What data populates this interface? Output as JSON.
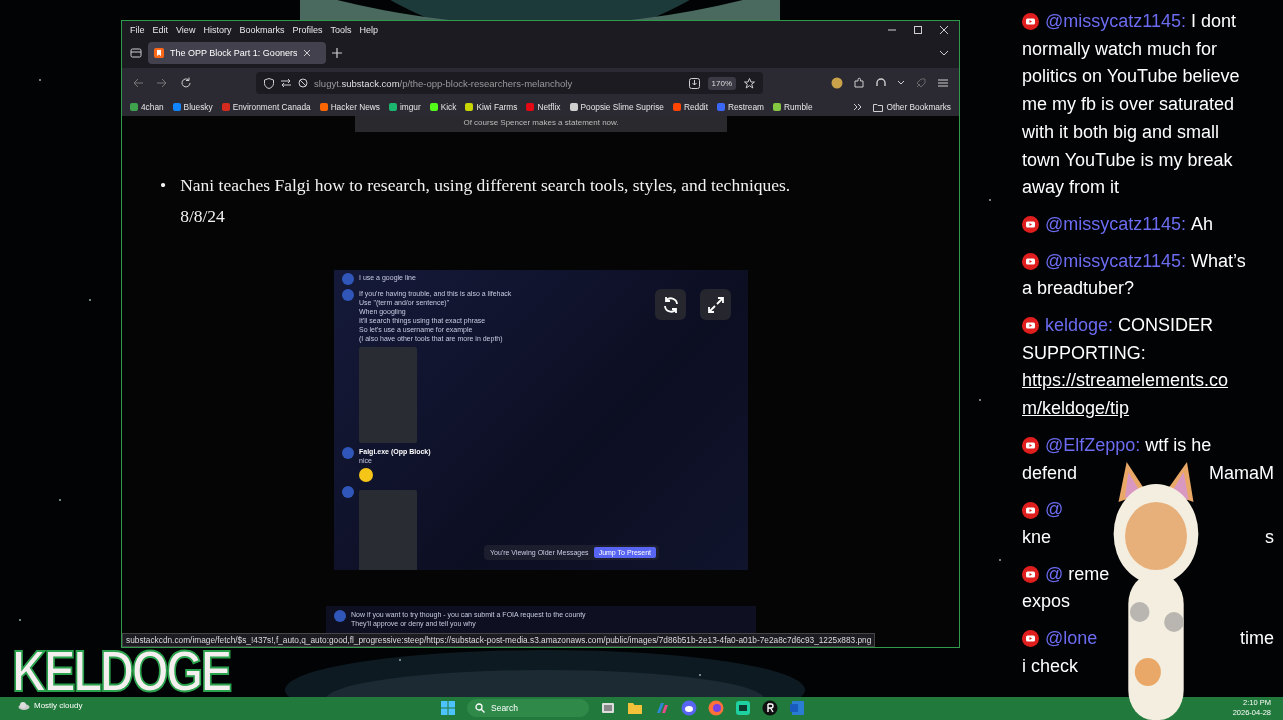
{
  "browser": {
    "menu": [
      "File",
      "Edit",
      "View",
      "History",
      "Bookmarks",
      "Profiles",
      "Tools",
      "Help"
    ],
    "tabs": [
      {
        "title": "The OPP Block Part 1: Gooners",
        "selected": true
      }
    ],
    "url": {
      "sub": "slugyt.",
      "domain": "substack.com",
      "path": "/p/the-opp-block-researchers-melancholy"
    },
    "zoom": "170%",
    "bookmarks": [
      {
        "label": "4chan",
        "color": "#3fa34d"
      },
      {
        "label": "Bluesky",
        "color": "#1185fe"
      },
      {
        "label": "Environment Canada",
        "color": "#d52b1e"
      },
      {
        "label": "Hacker News",
        "color": "#ff6600"
      },
      {
        "label": "imgur",
        "color": "#1bb76e"
      },
      {
        "label": "Kick",
        "color": "#53fc18"
      },
      {
        "label": "Kiwi Farms",
        "color": "#c7d600"
      },
      {
        "label": "Netflix",
        "color": "#e50914"
      },
      {
        "label": "Poopsie Slime Suprise",
        "color": "#d0d0d0"
      },
      {
        "label": "Reddit",
        "color": "#ff4500"
      },
      {
        "label": "Restream",
        "color": "#3a67f5"
      },
      {
        "label": "Rumble",
        "color": "#85c742"
      }
    ],
    "other_bookmarks": "Other Bookmarks",
    "status_url": "substackcdn.com/image/fetch/$s_!437s!,f_auto,q_auto:good,fl_progressive:steep/https://substack-post-media.s3.amazonaws.com/public/images/7d86b51b-2e13-4fa0-a01b-7e2a8c7d6c93_1225x883.png"
  },
  "article": {
    "caption": "Of course Spencer makes a statement now.",
    "bullets": [
      {
        "marker": "•",
        "text": "Nani teaches Falgi how to research, using different search tools, styles, and techniques.",
        "date": "8/8/24"
      }
    ],
    "embed": {
      "messages": [
        {
          "lines": [
            "I use a google line"
          ]
        },
        {
          "lines": [
            "If you're having trouble, and this is also a lifehack",
            "Use \"(term and/or sentence)\"",
            "When googling",
            "It'll search things using that exact phrase",
            "So let's use a username for example",
            "(I also have other tools that are more in depth)"
          ],
          "attachment": true
        },
        {
          "author": "Falgi.exe (Opp Block)",
          "lines": [
            "nice"
          ],
          "emoji": true
        },
        {
          "attachment": true
        }
      ],
      "banner": {
        "text": "You're Viewing Older Messages",
        "button": "Jump To Present"
      }
    },
    "embed2": {
      "lines": [
        "Now if you want to try though - you can submit a FOIA request to the county",
        "They'll approve or deny and tell you why"
      ]
    }
  },
  "chat": [
    {
      "author": "@missycatz1145:",
      "lines": [
        {
          "left": "I dont"
        },
        {
          "left": "normally watch much for"
        },
        {
          "left": "politics on YouTube believe"
        },
        {
          "left": "me my fb is over saturated"
        },
        {
          "left": "with it both big and small"
        },
        {
          "left": "town YouTube is my break"
        },
        {
          "left": "away from it"
        }
      ]
    },
    {
      "author": "@missycatz1145:",
      "lines": [
        {
          "left": "Ah"
        }
      ]
    },
    {
      "author": "@missycatz1145:",
      "lines": [
        {
          "left": "What’s"
        },
        {
          "left": "a breadtuber?"
        }
      ]
    },
    {
      "author": "keldoge:",
      "lines": [
        {
          "left": "CONSIDER"
        },
        {
          "left": "SUPPORTING:"
        },
        {
          "link": "https://streamelements.co"
        },
        {
          "link": "m/keldoge/tip"
        }
      ]
    },
    {
      "author": "@ElfZeppo:",
      "lines": [
        {
          "left": "wtf is he"
        },
        {
          "left": "defend",
          "right": "MamaM"
        }
      ]
    },
    {
      "author": "@",
      "author_alone": true,
      "lines": [
        {
          "left": "kne",
          "right": "s"
        }
      ]
    },
    {
      "author": "@",
      "lines": [
        {
          "left": "reme"
        },
        {
          "left": "expos"
        }
      ]
    },
    {
      "author": "@lone",
      "lines": [
        {
          "right": "time"
        },
        {
          "left": "i check"
        }
      ]
    }
  ],
  "overlay": {
    "logo": "KELDOGE"
  },
  "taskbar": {
    "weather": "Mostly cloudy",
    "search": "Search",
    "time": "2:10 PM",
    "date": "2026-04-28"
  }
}
